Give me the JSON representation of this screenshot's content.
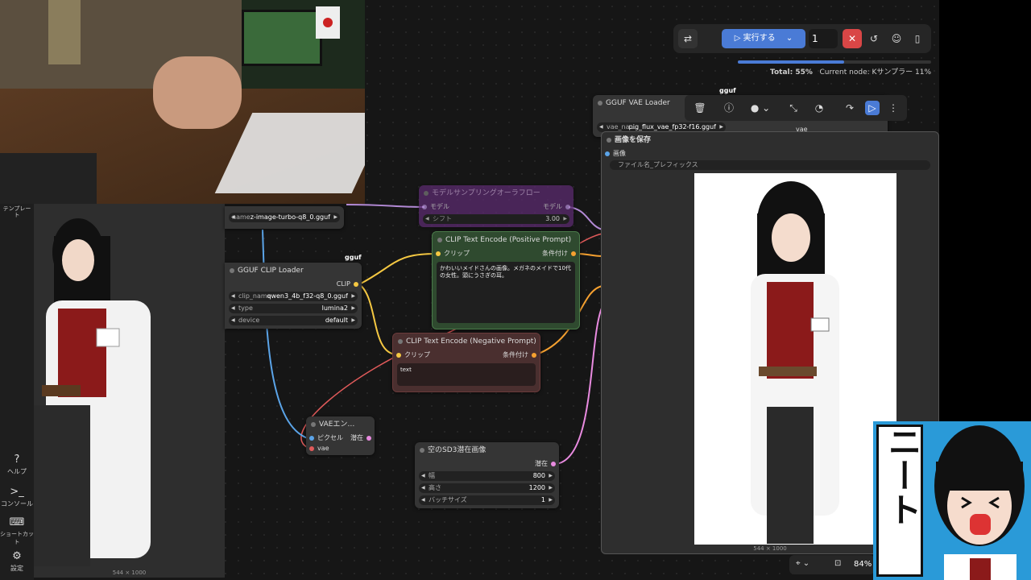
{
  "sidebar": {
    "templates": "テンプレート",
    "help": "ヘルプ",
    "console": "コンソール",
    "shortcuts": "ショートカット",
    "settings": "設定"
  },
  "left_preview": {
    "caption": "544 × 1000"
  },
  "toolbar": {
    "run_label": "実行する",
    "batch_count": "1",
    "progress_fraction": 0.55,
    "total_label": "Total: 55%",
    "current_node": "Current node: Kサンプラー 11%"
  },
  "nodes": {
    "model_loader": {
      "widget_name": "name",
      "widget_value": "z-image-turbo-q8_0.gguf"
    },
    "sampling": {
      "title": "モデルサンプリングオーラフロー",
      "in": "モデル",
      "out": "モデル",
      "shift_label": "シフト",
      "shift_value": "3.00"
    },
    "clip_loader": {
      "badge": "gguf",
      "title": "GGUF CLIP Loader",
      "out": "CLIP",
      "widgets": [
        {
          "name": "clip_name",
          "value": "qwen3_4b_f32-q8_0.gguf"
        },
        {
          "name": "type",
          "value": "lumina2"
        },
        {
          "name": "device",
          "value": "default"
        }
      ]
    },
    "positive": {
      "title": "CLIP Text Encode (Positive Prompt)",
      "in": "クリップ",
      "out": "条件付け",
      "text": "かわいいメイドさんの画像。メガネのメイドで10代の女性。頭にうさぎの耳。"
    },
    "negative": {
      "title": "CLIP Text Encode (Negative Prompt)",
      "in": "クリップ",
      "out": "条件付け",
      "text": "text"
    },
    "vae_decode": {
      "title": "VAEエン…",
      "in1": "ピクセル",
      "in2": "vae",
      "out": "潜在"
    },
    "latent": {
      "title": "空のSD3潜在画像",
      "out": "潜在",
      "widgets": [
        {
          "name": "幅",
          "value": "800"
        },
        {
          "name": "高さ",
          "value": "1200"
        },
        {
          "name": "バッチサイズ",
          "value": "1"
        }
      ]
    },
    "vae_loader": {
      "badge": "gguf",
      "title": "GGUF VAE Loader",
      "widget_name": "vae_na...",
      "widget_value": "pig_flux_vae_fp32-f16.gguf",
      "out": "vae"
    },
    "save_image": {
      "title": "画像を保存",
      "in": "画像",
      "prefix": "ファイル名_プレフィックス",
      "caption": "544 × 1000"
    }
  },
  "canvas_controls": {
    "zoom": "84%"
  },
  "mascot": {
    "text": "ニート"
  },
  "colors": {
    "accent": "#4a7bd6",
    "clip_link": "#f5c842",
    "model_link": "#b38ad6",
    "vae_link": "#e05a5a",
    "latent_link": "#e98be0",
    "pixel_link": "#5ba4e8"
  }
}
